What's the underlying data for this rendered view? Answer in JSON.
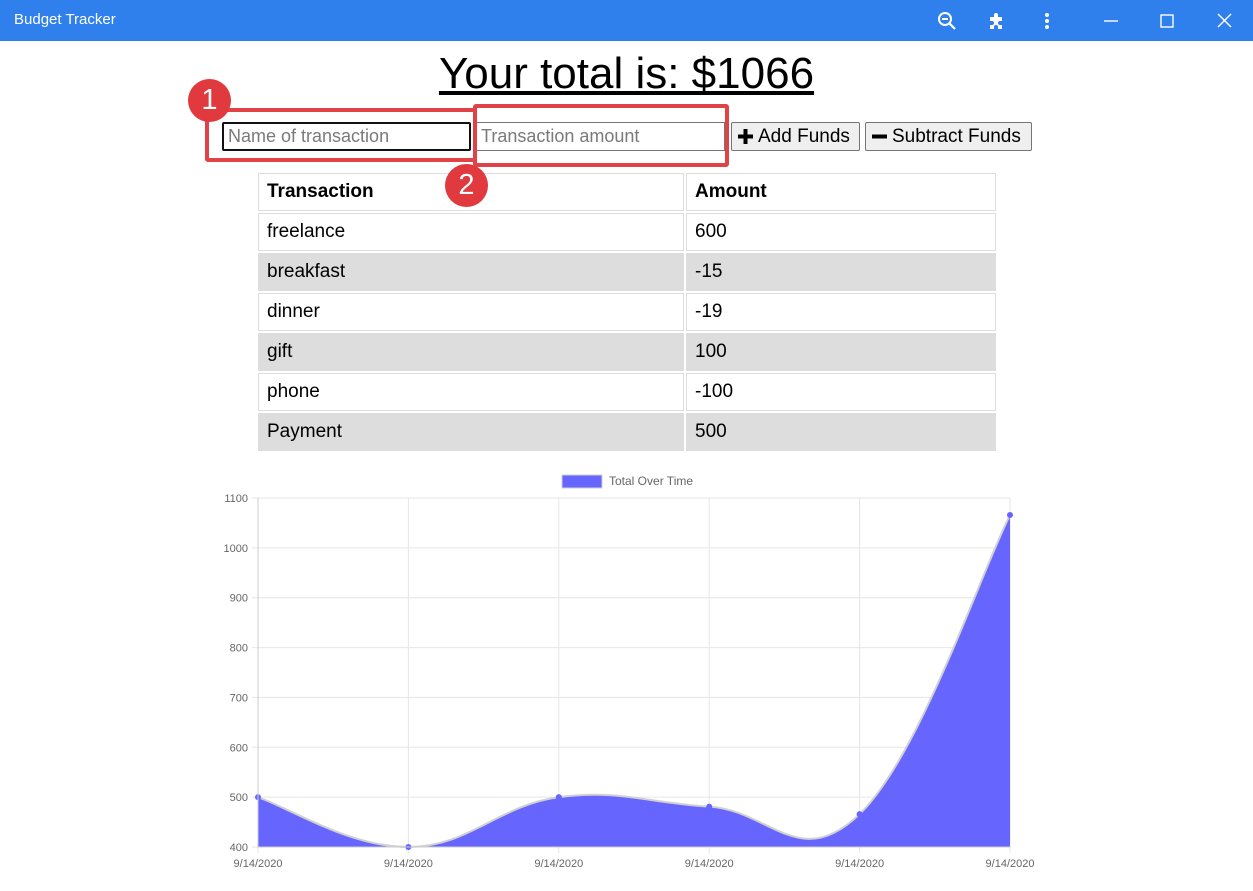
{
  "window": {
    "title": "Budget Tracker",
    "icons": [
      "zoom-out-icon",
      "extensions-icon",
      "more-menu-icon",
      "minimize-icon",
      "maximize-icon",
      "close-icon"
    ],
    "titlebar_color": "#2f80ed"
  },
  "heading": {
    "text": "Your total is: $1066"
  },
  "form": {
    "name_placeholder": "Name of transaction",
    "name_value": "",
    "amount_placeholder": "Transaction amount",
    "amount_value": "",
    "add_label": "Add Funds",
    "subtract_label": "Subtract Funds"
  },
  "annotations": {
    "badge_1": "1",
    "badge_2": "2",
    "color": "#e04347"
  },
  "table": {
    "headers": [
      "Transaction",
      "Amount"
    ],
    "rows": [
      [
        "freelance",
        "600"
      ],
      [
        "breakfast",
        "-15"
      ],
      [
        "dinner",
        "-19"
      ],
      [
        "gift",
        "100"
      ],
      [
        "phone",
        "-100"
      ],
      [
        "Payment",
        "500"
      ]
    ]
  },
  "chart_data": {
    "type": "area",
    "x": [
      "9/14/2020",
      "9/14/2020",
      "9/14/2020",
      "9/14/2020",
      "9/14/2020",
      "9/14/2020"
    ],
    "series": [
      {
        "name": "Total Over Time",
        "values": [
          500,
          400,
          500,
          481,
          466,
          1066
        ],
        "color": "#6666ff"
      }
    ],
    "yticks": [
      400,
      500,
      600,
      700,
      800,
      900,
      1000,
      1100
    ],
    "ylim": [
      400,
      1100
    ],
    "legend": "top-center",
    "grid": true,
    "title": "",
    "xlabel": "",
    "ylabel": ""
  }
}
